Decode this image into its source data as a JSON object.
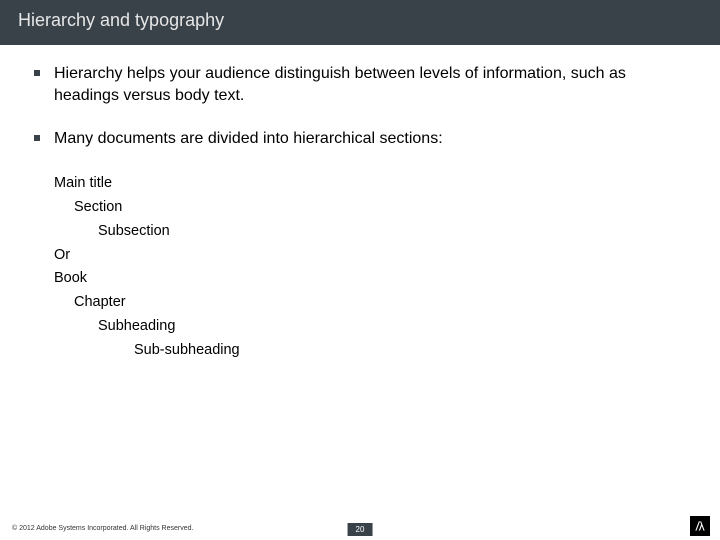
{
  "title": "Hierarchy and typography",
  "bullets": [
    {
      "prefix": "Hierarchy",
      "rest": " helps your audience distinguish between levels of information, such as headings versus body text."
    },
    {
      "text": "Many documents are divided into hierarchical sections:"
    }
  ],
  "hier": {
    "a0": "Main title",
    "a1": "Section",
    "a2": "Subsection",
    "or": "Or",
    "b0": "Book",
    "b1": "Chapter",
    "b2": "Subheading",
    "b3": "Sub-subheading"
  },
  "footer": {
    "copyright": "© 2012 Adobe Systems Incorporated. All Rights Reserved.",
    "page": "20"
  }
}
